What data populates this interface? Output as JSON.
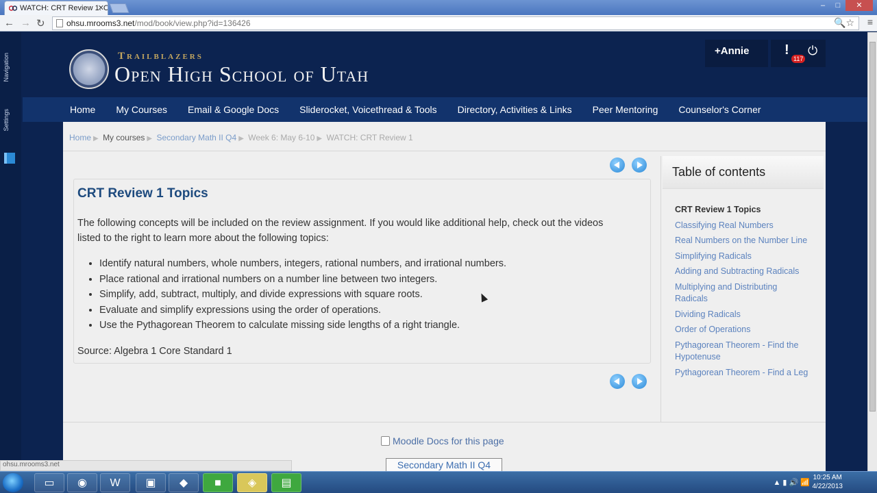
{
  "browser": {
    "tab_title": "WATCH: CRT Review 1: C",
    "tab_close": "✕",
    "url_host": "ohsu.mrooms3.net",
    "url_path": "/mod/book/view.php?id=136426",
    "back": "←",
    "forward": "→",
    "reload": "↻",
    "url_tools": "🔍☆",
    "wrench": "≡",
    "win_min": "–",
    "win_max": "□",
    "win_close": "✕"
  },
  "dock": {
    "navigation_label": "Navigation",
    "settings_label": "Settings"
  },
  "header": {
    "tagline": "Trailblazers",
    "school_name": "Open High School of Utah",
    "user_name": "+Annie",
    "alert_glyph": "!",
    "alert_count": "117",
    "power_glyph": "⏻"
  },
  "menu": {
    "items": [
      "Home",
      "My Courses",
      "Email & Google Docs",
      "Sliderocket, Voicethread & Tools",
      "Directory, Activities & Links",
      "Peer Mentoring",
      "Counselor's Corner"
    ]
  },
  "breadcrumb": {
    "items": [
      "Home",
      "My courses",
      "Secondary Math II Q4",
      "Week 6: May 6-10",
      "WATCH: CRT Review 1"
    ],
    "separator": "▶"
  },
  "book": {
    "title": "CRT Review 1 Topics",
    "intro": "The following concepts will be included on the review assignment. If you would like additional help, check out the videos listed to the right to learn more about the following topics:",
    "topics": [
      "Identify natural numbers, whole numbers, integers, rational numbers, and irrational numbers.",
      "Place rational and irrational numbers on a number line between two integers.",
      "Simplify, add, subtract, multiply, and divide expressions with square roots.",
      "Evaluate and simplify expressions using the order of operations.",
      "Use the Pythagorean Theorem to calculate missing side lengths of a right triangle."
    ],
    "source": "Source: Algebra 1 Core Standard 1"
  },
  "toc": {
    "heading": "Table of contents",
    "items": [
      "CRT Review 1 Topics",
      "Classifying Real Numbers",
      "Real Numbers on the Number Line",
      "Simplifying Radicals",
      "Adding and Subtracting Radicals",
      "Multiplying and Distributing Radicals",
      "Dividing Radicals",
      "Order of Operations",
      "Pythagorean Theorem - Find the Hypotenuse",
      "Pythagorean Theorem - Find a Leg"
    ]
  },
  "footer": {
    "docs_link": "Moodle Docs for this page",
    "course_button": "Secondary Math II Q4"
  },
  "status_url": "ohsu.mrooms3.net",
  "taskbar": {
    "time": "10:25 AM",
    "date": "4/22/2013",
    "tray_icons": "▲ ▮ 🔊 📶"
  },
  "colors": {
    "page_bg": "#0c2350",
    "menu_bg": "#12336c",
    "link": "#5b82be",
    "title": "#1d4a7e",
    "gold": "#c4a760"
  }
}
